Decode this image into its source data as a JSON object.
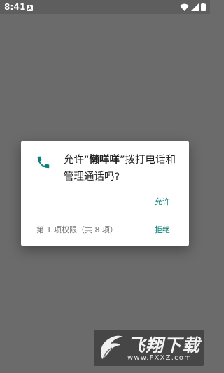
{
  "status_bar": {
    "time": "8:41",
    "icons": [
      "notification-a-icon",
      "wifi-icon",
      "cell-signal-icon",
      "battery-icon"
    ]
  },
  "dialog": {
    "icon": "phone-icon",
    "accent_color": "#0b8077",
    "message_prefix": "允许“",
    "app_name": "懒咩咩",
    "message_suffix": "”拨打电话和管理通话吗?",
    "allow_label": "允许",
    "permission_counter": "第 1 项权限（共 8 项）",
    "deny_label": "拒绝"
  },
  "watermark": {
    "title": "飞翔下载",
    "url": "www.FXXZ.com"
  }
}
